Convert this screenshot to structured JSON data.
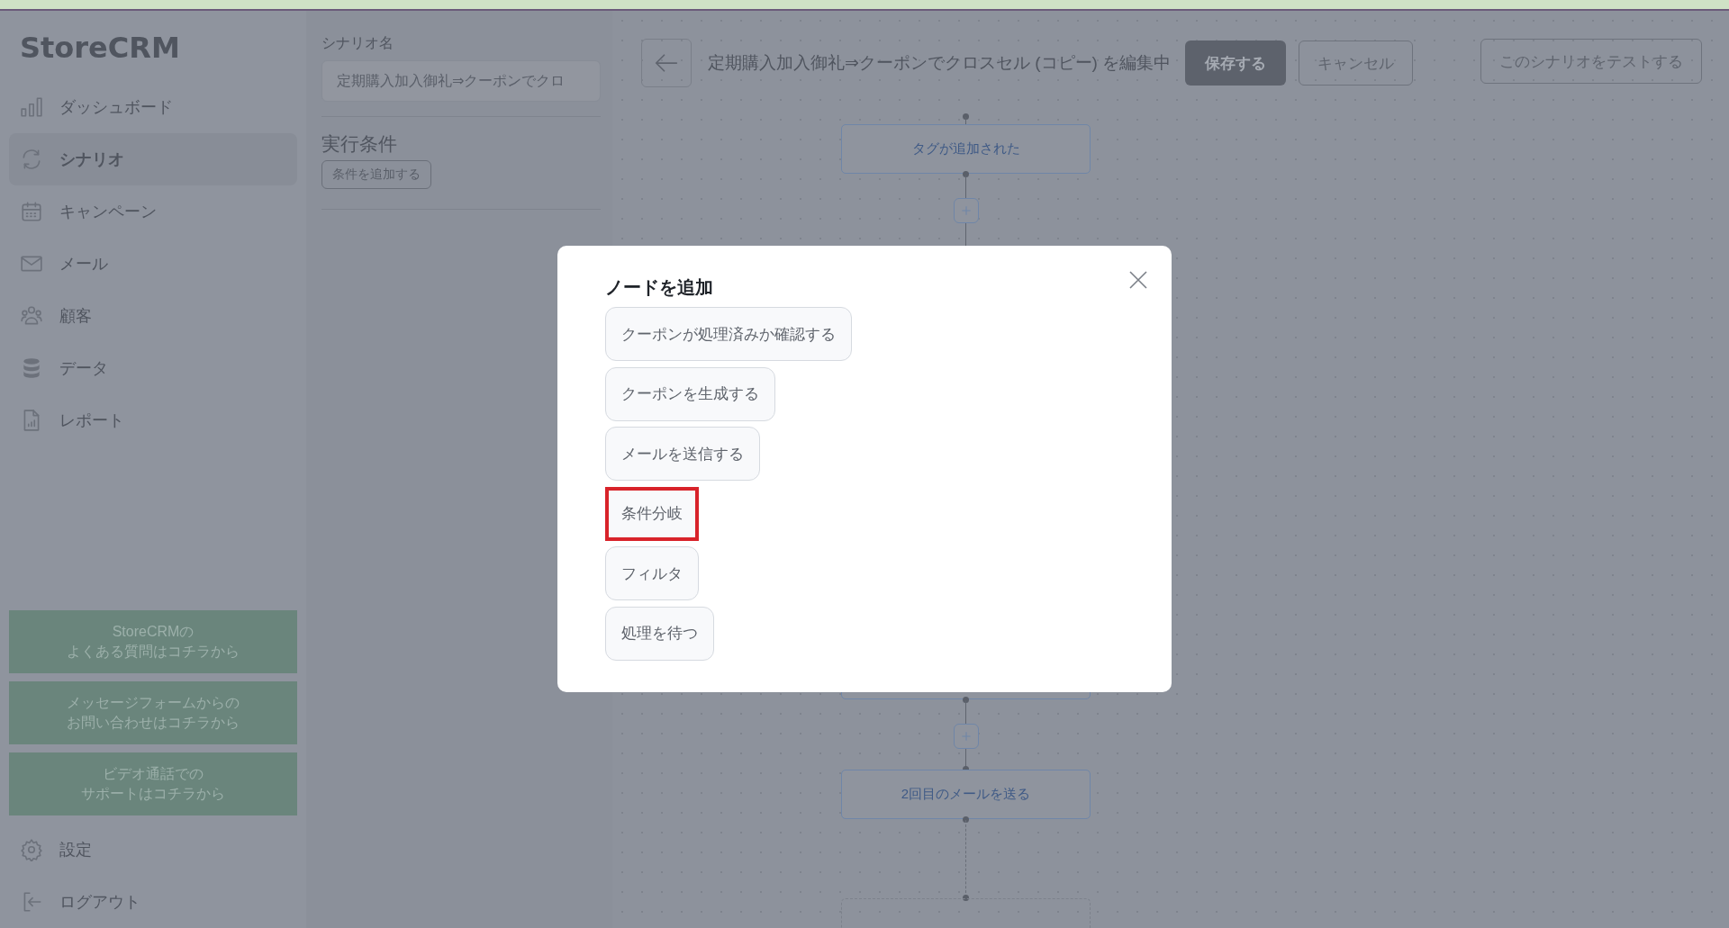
{
  "sidebar": {
    "logo": "StoreCRM",
    "items": [
      {
        "label": "ダッシュボード",
        "selected": false
      },
      {
        "label": "シナリオ",
        "selected": true
      },
      {
        "label": "キャンペーン",
        "selected": false
      },
      {
        "label": "メール",
        "selected": false
      },
      {
        "label": "顧客",
        "selected": false
      },
      {
        "label": "データ",
        "selected": false
      },
      {
        "label": "レポート",
        "selected": false
      }
    ],
    "support_links": [
      {
        "lines": [
          "StoreCRMの",
          "よくある質問はコチラから"
        ]
      },
      {
        "lines": [
          "メッセージフォームからの",
          "お問い合わせはコチラから"
        ]
      },
      {
        "lines": [
          "ビデオ通話での",
          "サポートはコチラから"
        ]
      }
    ],
    "footer_items": [
      {
        "label": "設定"
      },
      {
        "label": "ログアウト"
      }
    ]
  },
  "scenario_panel": {
    "name_label": "シナリオ名",
    "name_value": "定期購入加入御礼⇒クーポンでクロ",
    "conditions_title": "実行条件",
    "add_condition_button": "条件を追加する"
  },
  "editor": {
    "title": "定期購入加入御礼⇒クーポンでクロスセル (コピー) を編集中",
    "save_button": "保存する",
    "cancel_button": "キャンセル",
    "test_button": "このシナリオをテストする"
  },
  "flow": {
    "steps": [
      {
        "kind": "node",
        "label": "タグが追加された"
      },
      {
        "kind": "add"
      },
      {
        "kind": "node"
      },
      {
        "kind": "add"
      },
      {
        "kind": "node",
        "label": "2回目のメールを送る"
      },
      {
        "kind": "pending"
      }
    ]
  },
  "modal": {
    "title": "ノードを追加",
    "options": [
      {
        "label": "クーポンが処理済みか確認する",
        "highlighted": false
      },
      {
        "label": "クーポンを生成する",
        "highlighted": false
      },
      {
        "label": "メールを送信する",
        "highlighted": false
      },
      {
        "label": "条件分岐",
        "highlighted": true
      },
      {
        "label": "フィルタ",
        "highlighted": false
      },
      {
        "label": "処理を待つ",
        "highlighted": false
      }
    ]
  }
}
